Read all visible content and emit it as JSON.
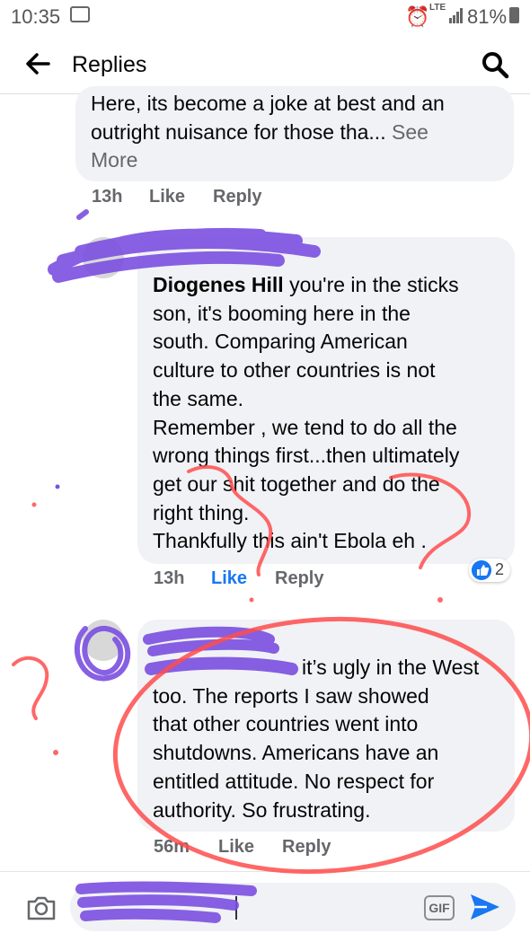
{
  "status_bar": {
    "time": "10:35",
    "network": "LTE",
    "battery_percent": "81%"
  },
  "header": {
    "title": "Replies"
  },
  "comments": [
    {
      "line1": "Here, its become a joke at best and an",
      "line2_text": "outright nuisance for those tha... ",
      "see_more_a": "See",
      "see_more_b": "More",
      "time": "13h",
      "like": "Like",
      "reply": "Reply"
    },
    {
      "author": "Diogenes Hill",
      "lines": [
        " you're in the sticks",
        "son, it's booming here in the",
        "south. Comparing American",
        "culture to other countries is not",
        "the same.",
        "Remember , we tend to do all the",
        "wrong things first...then ultimately",
        "get our shit together and do the",
        "right thing.",
        "Thankfully this ain't Ebola eh ."
      ],
      "time": "13h",
      "like": "Like",
      "reply": "Reply",
      "reaction_count": "2"
    },
    {
      "lines": [
        "it’s ugly in the West",
        "too. The reports I saw showed",
        "that other countries went into",
        "shutdowns. Americans have an",
        "entitled attitude. No respect for",
        "authority. So frustrating."
      ],
      "time": "56m",
      "like": "Like",
      "reply": "Reply"
    }
  ],
  "composer": {
    "gif_label": "GIF"
  },
  "colors": {
    "bubble": "#f0f2f5",
    "link_blue": "#1877f2",
    "meta_gray": "#65676b",
    "scribble_purple": "#7b4fe0",
    "annotation_red": "#ff4d4d"
  },
  "icons": [
    "back-arrow-icon",
    "search-icon",
    "camera-icon",
    "gif-icon",
    "send-icon",
    "like-reaction-icon",
    "alarm-icon",
    "mail-icon",
    "signal-icon",
    "battery-icon"
  ]
}
